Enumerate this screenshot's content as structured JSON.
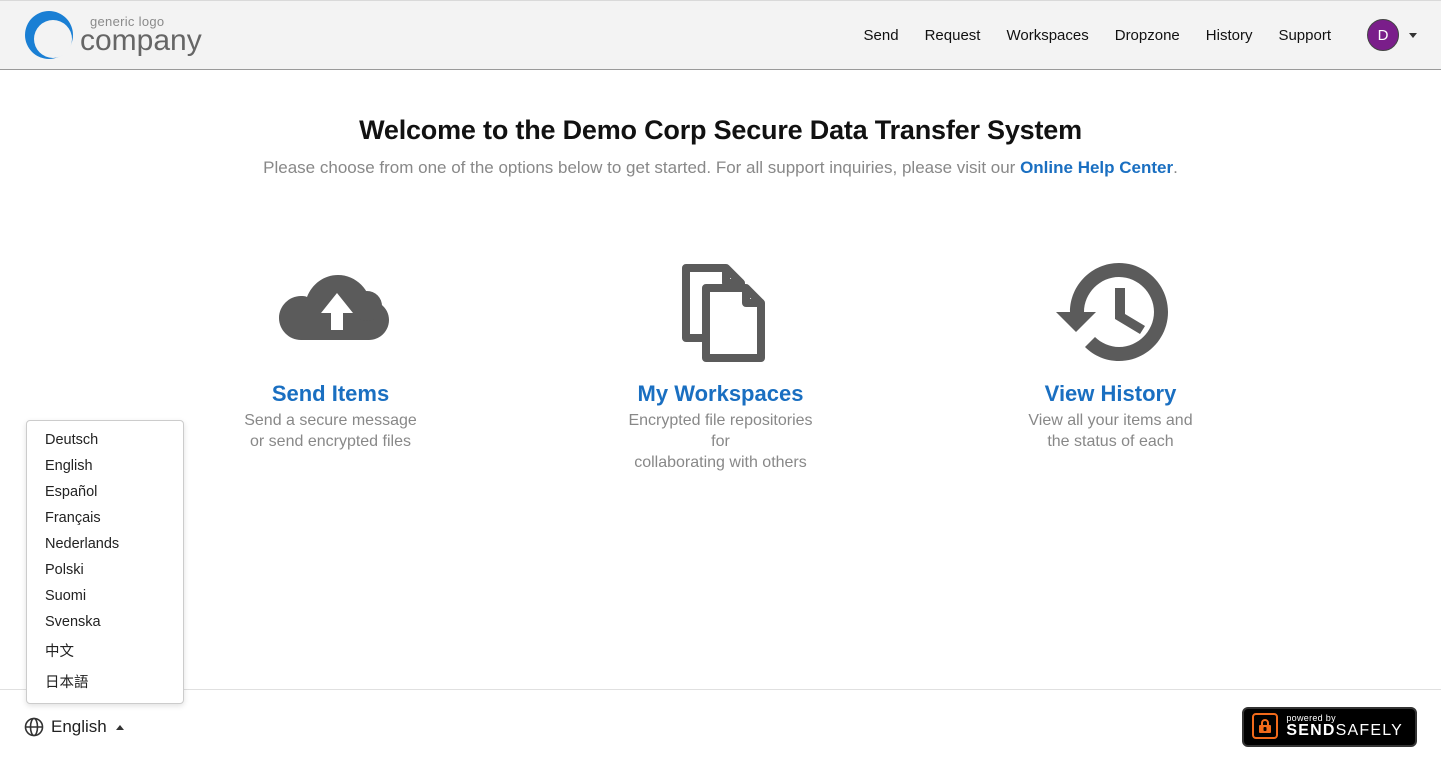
{
  "logo": {
    "top_text": "generic logo",
    "bottom_text": "company"
  },
  "nav": {
    "items": [
      "Send",
      "Request",
      "Workspaces",
      "Dropzone",
      "History",
      "Support"
    ],
    "avatar_letter": "D"
  },
  "main": {
    "welcome": "Welcome to the Demo Corp Secure Data Transfer System",
    "subtitle_prefix": "Please choose from one of the options below to get started. For all support inquiries, please visit our ",
    "help_link_text": "Online Help Center",
    "subtitle_suffix": "."
  },
  "cards": [
    {
      "title": "Send Items",
      "desc_line1": "Send a secure message",
      "desc_line2": "or send encrypted files"
    },
    {
      "title": "My Workspaces",
      "desc_line1": "Encrypted file repositories for",
      "desc_line2": "collaborating with others"
    },
    {
      "title": "View History",
      "desc_line1": "View all your items and",
      "desc_line2": "the status of each"
    }
  ],
  "languages": [
    "Deutsch",
    "English",
    "Español",
    "Français",
    "Nederlands",
    "Polski",
    "Suomi",
    "Svenska",
    "中文",
    "日本語"
  ],
  "footer": {
    "current_language": "English",
    "powered_top": "powered by",
    "powered_brand_bold": "SEND",
    "powered_brand_light": "SAFELY"
  }
}
